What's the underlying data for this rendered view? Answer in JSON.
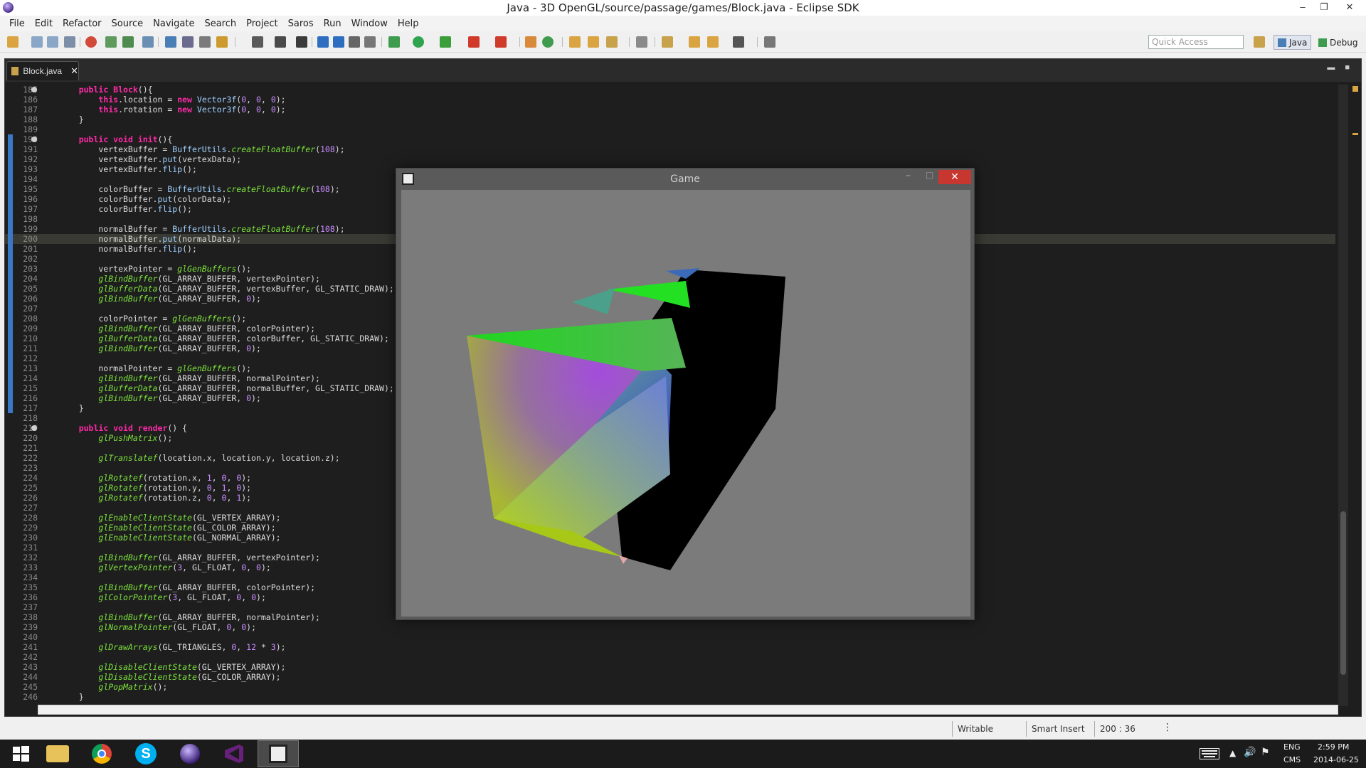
{
  "window": {
    "title": "Java - 3D OpenGL/source/passage/games/Block.java - Eclipse SDK",
    "controls": [
      "–",
      "❐",
      "✕"
    ]
  },
  "menu": [
    "File",
    "Edit",
    "Refactor",
    "Source",
    "Navigate",
    "Search",
    "Project",
    "Saros",
    "Run",
    "Window",
    "Help"
  ],
  "toolbar": {
    "quick_access_placeholder": "Quick Access",
    "perspectives": [
      "Java",
      "Debug"
    ],
    "icons": [
      "new-icon",
      "save-icon",
      "save-all-icon",
      "print-icon",
      "search-icon",
      "build-icon",
      "run-history-icon",
      "debug-icon",
      "run-icon",
      "external-tools-icon",
      "new-class-icon",
      "open-type-icon",
      "open-task-icon",
      "search-icon",
      "next-annotation-icon",
      "prev-annotation-icon",
      "back-icon",
      "forward-icon",
      "pin-icon"
    ]
  },
  "editor": {
    "tab_label": "Block.java",
    "tab_close": "✕",
    "lines": [
      {
        "n": "185",
        "fold": true,
        "segs": [
          [
            "    ",
            ""
          ],
          [
            "public ",
            "kw"
          ],
          [
            "Block",
            "kw"
          ],
          [
            "(){",
            ""
          ]
        ]
      },
      {
        "n": "186",
        "segs": [
          [
            "        ",
            ""
          ],
          [
            "this",
            "kw"
          ],
          [
            ".location = ",
            ""
          ],
          [
            "new ",
            "kw"
          ],
          [
            "Vector3f",
            "cls"
          ],
          [
            "(",
            ""
          ],
          [
            "0",
            "num"
          ],
          [
            ", ",
            ""
          ],
          [
            "0",
            "num"
          ],
          [
            ", ",
            ""
          ],
          [
            "0",
            "num"
          ],
          [
            ");",
            ""
          ]
        ]
      },
      {
        "n": "187",
        "segs": [
          [
            "        ",
            ""
          ],
          [
            "this",
            "kw"
          ],
          [
            ".rotation = ",
            ""
          ],
          [
            "new ",
            "kw"
          ],
          [
            "Vector3f",
            "cls"
          ],
          [
            "(",
            ""
          ],
          [
            "0",
            "num"
          ],
          [
            ", ",
            ""
          ],
          [
            "0",
            "num"
          ],
          [
            ", ",
            ""
          ],
          [
            "0",
            "num"
          ],
          [
            ");",
            ""
          ]
        ]
      },
      {
        "n": "188",
        "segs": [
          [
            "    }",
            ""
          ]
        ]
      },
      {
        "n": "189",
        "segs": []
      },
      {
        "n": "190",
        "fold": true,
        "segs": [
          [
            "    ",
            ""
          ],
          [
            "public ",
            "kw"
          ],
          [
            "void ",
            "kw"
          ],
          [
            "init",
            "kw"
          ],
          [
            "(){",
            ""
          ]
        ]
      },
      {
        "n": "191",
        "segs": [
          [
            "        vertexBuffer = ",
            ""
          ],
          [
            "BufferUtils",
            "cls"
          ],
          [
            ".",
            ""
          ],
          [
            "createFloatBuffer",
            "fn"
          ],
          [
            "(",
            ""
          ],
          [
            "108",
            "num"
          ],
          [
            ");",
            ""
          ]
        ]
      },
      {
        "n": "192",
        "segs": [
          [
            "        vertexBuffer.",
            ""
          ],
          [
            "put",
            "cls"
          ],
          [
            "(vertexData);",
            ""
          ]
        ]
      },
      {
        "n": "193",
        "segs": [
          [
            "        vertexBuffer.",
            ""
          ],
          [
            "flip",
            "cls"
          ],
          [
            "();",
            ""
          ]
        ]
      },
      {
        "n": "194",
        "segs": []
      },
      {
        "n": "195",
        "segs": [
          [
            "        colorBuffer = ",
            ""
          ],
          [
            "BufferUtils",
            "cls"
          ],
          [
            ".",
            ""
          ],
          [
            "createFloatBuffer",
            "fn"
          ],
          [
            "(",
            ""
          ],
          [
            "108",
            "num"
          ],
          [
            ");",
            ""
          ]
        ]
      },
      {
        "n": "196",
        "segs": [
          [
            "        colorBuffer.",
            ""
          ],
          [
            "put",
            "cls"
          ],
          [
            "(colorData);",
            ""
          ]
        ]
      },
      {
        "n": "197",
        "segs": [
          [
            "        colorBuffer.",
            ""
          ],
          [
            "flip",
            "cls"
          ],
          [
            "();",
            ""
          ]
        ]
      },
      {
        "n": "198",
        "segs": []
      },
      {
        "n": "199",
        "segs": [
          [
            "        normalBuffer = ",
            ""
          ],
          [
            "BufferUtils",
            "cls"
          ],
          [
            ".",
            ""
          ],
          [
            "createFloatBuffer",
            "fn"
          ],
          [
            "(",
            ""
          ],
          [
            "108",
            "num"
          ],
          [
            ");",
            ""
          ]
        ]
      },
      {
        "n": "200",
        "current": true,
        "segs": [
          [
            "        normalBuffer.",
            ""
          ],
          [
            "put",
            "cls"
          ],
          [
            "(normalData);",
            ""
          ]
        ]
      },
      {
        "n": "201",
        "segs": [
          [
            "        normalBuffer.",
            ""
          ],
          [
            "flip",
            "cls"
          ],
          [
            "();",
            ""
          ]
        ]
      },
      {
        "n": "202",
        "segs": []
      },
      {
        "n": "203",
        "segs": [
          [
            "        vertexPointer = ",
            ""
          ],
          [
            "glGenBuffers",
            "fn"
          ],
          [
            "();",
            ""
          ]
        ]
      },
      {
        "n": "204",
        "segs": [
          [
            "        ",
            ""
          ],
          [
            "glBindBuffer",
            "fn"
          ],
          [
            "(GL_ARRAY_BUFFER, vertexPointer);",
            ""
          ]
        ]
      },
      {
        "n": "205",
        "segs": [
          [
            "        ",
            ""
          ],
          [
            "glBufferData",
            "fn"
          ],
          [
            "(GL_ARRAY_BUFFER, vertexBuffer, GL_STATIC_DRAW);",
            ""
          ]
        ]
      },
      {
        "n": "206",
        "segs": [
          [
            "        ",
            ""
          ],
          [
            "glBindBuffer",
            "fn"
          ],
          [
            "(GL_ARRAY_BUFFER, ",
            ""
          ],
          [
            "0",
            "num"
          ],
          [
            ");",
            ""
          ]
        ]
      },
      {
        "n": "207",
        "segs": []
      },
      {
        "n": "208",
        "segs": [
          [
            "        colorPointer = ",
            ""
          ],
          [
            "glGenBuffers",
            "fn"
          ],
          [
            "();",
            ""
          ]
        ]
      },
      {
        "n": "209",
        "segs": [
          [
            "        ",
            ""
          ],
          [
            "glBindBuffer",
            "fn"
          ],
          [
            "(GL_ARRAY_BUFFER, colorPointer);",
            ""
          ]
        ]
      },
      {
        "n": "210",
        "segs": [
          [
            "        ",
            ""
          ],
          [
            "glBufferData",
            "fn"
          ],
          [
            "(GL_ARRAY_BUFFER, colorBuffer, GL_STATIC_DRAW);",
            ""
          ]
        ]
      },
      {
        "n": "211",
        "segs": [
          [
            "        ",
            ""
          ],
          [
            "glBindBuffer",
            "fn"
          ],
          [
            "(GL_ARRAY_BUFFER, ",
            ""
          ],
          [
            "0",
            "num"
          ],
          [
            ");",
            ""
          ]
        ]
      },
      {
        "n": "212",
        "segs": []
      },
      {
        "n": "213",
        "segs": [
          [
            "        normalPointer = ",
            ""
          ],
          [
            "glGenBuffers",
            "fn"
          ],
          [
            "();",
            ""
          ]
        ]
      },
      {
        "n": "214",
        "segs": [
          [
            "        ",
            ""
          ],
          [
            "glBindBuffer",
            "fn"
          ],
          [
            "(GL_ARRAY_BUFFER, normalPointer);",
            ""
          ]
        ]
      },
      {
        "n": "215",
        "segs": [
          [
            "        ",
            ""
          ],
          [
            "glBufferData",
            "fn"
          ],
          [
            "(GL_ARRAY_BUFFER, normalBuffer, GL_STATIC_DRAW);",
            ""
          ]
        ]
      },
      {
        "n": "216",
        "segs": [
          [
            "        ",
            ""
          ],
          [
            "glBindBuffer",
            "fn"
          ],
          [
            "(GL_ARRAY_BUFFER, ",
            ""
          ],
          [
            "0",
            "num"
          ],
          [
            ");",
            ""
          ]
        ]
      },
      {
        "n": "217",
        "segs": [
          [
            "    }",
            ""
          ]
        ]
      },
      {
        "n": "218",
        "segs": []
      },
      {
        "n": "219",
        "fold": true,
        "segs": [
          [
            "    ",
            ""
          ],
          [
            "public ",
            "kw"
          ],
          [
            "void ",
            "kw"
          ],
          [
            "render",
            "kw"
          ],
          [
            "() {",
            ""
          ]
        ]
      },
      {
        "n": "220",
        "segs": [
          [
            "        ",
            ""
          ],
          [
            "glPushMatrix",
            "fn"
          ],
          [
            "();",
            ""
          ]
        ]
      },
      {
        "n": "221",
        "segs": []
      },
      {
        "n": "222",
        "segs": [
          [
            "        ",
            ""
          ],
          [
            "glTranslatef",
            "fn"
          ],
          [
            "(location.x, location.y, location.z);",
            ""
          ]
        ]
      },
      {
        "n": "223",
        "segs": []
      },
      {
        "n": "224",
        "segs": [
          [
            "        ",
            ""
          ],
          [
            "glRotatef",
            "fn"
          ],
          [
            "(rotation.x, ",
            ""
          ],
          [
            "1",
            "num"
          ],
          [
            ", ",
            ""
          ],
          [
            "0",
            "num"
          ],
          [
            ", ",
            ""
          ],
          [
            "0",
            "num"
          ],
          [
            ");",
            ""
          ]
        ]
      },
      {
        "n": "225",
        "segs": [
          [
            "        ",
            ""
          ],
          [
            "glRotatef",
            "fn"
          ],
          [
            "(rotation.y, ",
            ""
          ],
          [
            "0",
            "num"
          ],
          [
            ", ",
            ""
          ],
          [
            "1",
            "num"
          ],
          [
            ", ",
            ""
          ],
          [
            "0",
            "num"
          ],
          [
            ");",
            ""
          ]
        ]
      },
      {
        "n": "226",
        "segs": [
          [
            "        ",
            ""
          ],
          [
            "glRotatef",
            "fn"
          ],
          [
            "(rotation.z, ",
            ""
          ],
          [
            "0",
            "num"
          ],
          [
            ", ",
            ""
          ],
          [
            "0",
            "num"
          ],
          [
            ", ",
            ""
          ],
          [
            "1",
            "num"
          ],
          [
            ");",
            ""
          ]
        ]
      },
      {
        "n": "227",
        "segs": []
      },
      {
        "n": "228",
        "segs": [
          [
            "        ",
            ""
          ],
          [
            "glEnableClientState",
            "fn"
          ],
          [
            "(GL_VERTEX_ARRAY);",
            ""
          ]
        ]
      },
      {
        "n": "229",
        "segs": [
          [
            "        ",
            ""
          ],
          [
            "glEnableClientState",
            "fn"
          ],
          [
            "(GL_COLOR_ARRAY);",
            ""
          ]
        ]
      },
      {
        "n": "230",
        "segs": [
          [
            "        ",
            ""
          ],
          [
            "glEnableClientState",
            "fn"
          ],
          [
            "(GL_NORMAL_ARRAY);",
            ""
          ]
        ]
      },
      {
        "n": "231",
        "segs": []
      },
      {
        "n": "232",
        "segs": [
          [
            "        ",
            ""
          ],
          [
            "glBindBuffer",
            "fn"
          ],
          [
            "(GL_ARRAY_BUFFER, vertexPointer);",
            ""
          ]
        ]
      },
      {
        "n": "233",
        "segs": [
          [
            "        ",
            ""
          ],
          [
            "glVertexPointer",
            "fn"
          ],
          [
            "(",
            ""
          ],
          [
            "3",
            "num"
          ],
          [
            ", GL_FLOAT, ",
            ""
          ],
          [
            "0",
            "num"
          ],
          [
            ", ",
            ""
          ],
          [
            "0",
            "num"
          ],
          [
            ");",
            ""
          ]
        ]
      },
      {
        "n": "234",
        "segs": []
      },
      {
        "n": "235",
        "segs": [
          [
            "        ",
            ""
          ],
          [
            "glBindBuffer",
            "fn"
          ],
          [
            "(GL_ARRAY_BUFFER, colorPointer);",
            ""
          ]
        ]
      },
      {
        "n": "236",
        "segs": [
          [
            "        ",
            ""
          ],
          [
            "glColorPointer",
            "fn"
          ],
          [
            "(",
            ""
          ],
          [
            "3",
            "num"
          ],
          [
            ", GL_FLOAT, ",
            ""
          ],
          [
            "0",
            "num"
          ],
          [
            ", ",
            ""
          ],
          [
            "0",
            "num"
          ],
          [
            ");",
            ""
          ]
        ]
      },
      {
        "n": "237",
        "segs": []
      },
      {
        "n": "238",
        "segs": [
          [
            "        ",
            ""
          ],
          [
            "glBindBuffer",
            "fn"
          ],
          [
            "(GL_ARRAY_BUFFER, normalPointer);",
            ""
          ]
        ]
      },
      {
        "n": "239",
        "segs": [
          [
            "        ",
            ""
          ],
          [
            "glNormalPointer",
            "fn"
          ],
          [
            "(GL_FLOAT, ",
            ""
          ],
          [
            "0",
            "num"
          ],
          [
            ", ",
            ""
          ],
          [
            "0",
            "num"
          ],
          [
            ");",
            ""
          ]
        ]
      },
      {
        "n": "240",
        "segs": []
      },
      {
        "n": "241",
        "segs": [
          [
            "        ",
            ""
          ],
          [
            "glDrawArrays",
            "fn"
          ],
          [
            "(GL_TRIANGLES, ",
            ""
          ],
          [
            "0",
            "num"
          ],
          [
            ", ",
            ""
          ],
          [
            "12",
            "num"
          ],
          [
            " * ",
            ""
          ],
          [
            "3",
            "num"
          ],
          [
            ");",
            ""
          ]
        ]
      },
      {
        "n": "242",
        "segs": []
      },
      {
        "n": "243",
        "segs": [
          [
            "        ",
            ""
          ],
          [
            "glDisableClientState",
            "fn"
          ],
          [
            "(GL_VERTEX_ARRAY);",
            ""
          ]
        ]
      },
      {
        "n": "244",
        "segs": [
          [
            "        ",
            ""
          ],
          [
            "glDisableClientState",
            "fn"
          ],
          [
            "(GL_COLOR_ARRAY);",
            ""
          ]
        ]
      },
      {
        "n": "245",
        "segs": [
          [
            "        ",
            ""
          ],
          [
            "glPopMatrix",
            "fn"
          ],
          [
            "();",
            ""
          ]
        ]
      },
      {
        "n": "246",
        "segs": [
          [
            "    }",
            ""
          ]
        ]
      }
    ]
  },
  "game_window": {
    "title": "Game",
    "close": "✕",
    "min": "–",
    "max": "□"
  },
  "status": {
    "writable": "Writable",
    "insert_mode": "Smart Insert",
    "position": "200 : 36"
  },
  "taskbar": {
    "apps": [
      "start-icon",
      "file-explorer-icon",
      "chrome-icon",
      "skype-icon",
      "eclipse-icon",
      "visual-studio-icon",
      "java-app-icon"
    ],
    "lang_top": "ENG",
    "lang_bottom": "CMS",
    "time": "2:59 PM",
    "date": "2014-06-25"
  },
  "colors": {
    "editor_bg": "#1e1e1e",
    "keyword": "#ff2aa8",
    "method": "#7be03c",
    "number": "#c98cff",
    "close_red": "#c7372f"
  }
}
